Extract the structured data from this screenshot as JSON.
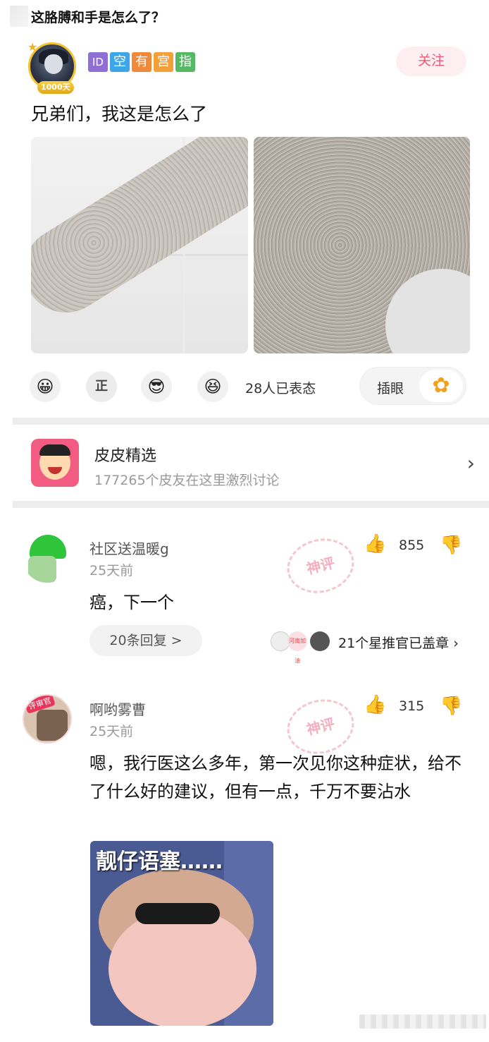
{
  "header": {
    "title": "这胳膊和手是怎么了？"
  },
  "post": {
    "author": {
      "avatar_badge": "1000天",
      "badges": [
        "ID",
        "空",
        "有",
        "宫",
        "指"
      ]
    },
    "follow_label": "关注",
    "text": "兄弟们，我这是怎么了",
    "reactions": {
      "icons": [
        "grin-emoji-icon",
        "zheng-badge-icon",
        "sunglasses-emoji-icon",
        "laugh-emoji-icon"
      ],
      "r2_label": "正",
      "count_label": "28人已表态",
      "insert_label": "插眼"
    }
  },
  "topic": {
    "title": "皮皮精选",
    "subtitle": "177265个皮友在这里激烈讨论"
  },
  "comments": [
    {
      "name": "社区送温暖g",
      "time": "25天前",
      "likes": "855",
      "text": "癌，下一个",
      "watermark": "神评",
      "reply_label": "20条回复 >",
      "stamp_text": "21个星推官已盖章 ›",
      "stamp_mini_label": "河南加油"
    },
    {
      "name": "啊哟雾曹",
      "time": "25天前",
      "likes": "315",
      "text": "嗯，我行医这么多年，第一次见你这种症状，给不了什么好的建议，但有一点，千万不要沾水",
      "watermark": "神评",
      "avatar_tag": "评审官",
      "meme_caption": "靓仔语塞……"
    }
  ],
  "colors": {
    "accent_pink": "#f0587a",
    "topic_icon": "#f35c82",
    "divider": "#ededed"
  }
}
